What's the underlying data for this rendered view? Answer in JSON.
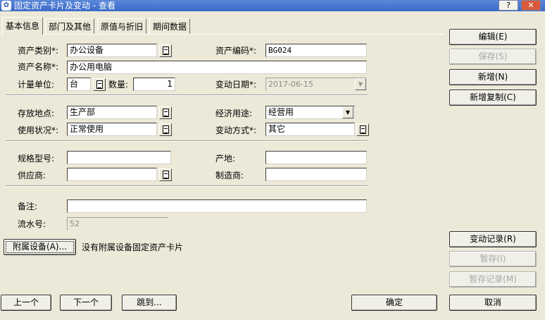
{
  "window": {
    "title": "固定资产卡片及变动 - 查看",
    "help_label": "?",
    "close_label": "✕"
  },
  "tabs": [
    {
      "label": "基本信息",
      "active": true
    },
    {
      "label": "部门及其他",
      "active": false
    },
    {
      "label": "原值与折旧",
      "active": false
    },
    {
      "label": "期间数据",
      "active": false
    }
  ],
  "form": {
    "asset_category": {
      "label": "资产类别*:",
      "value": "办公设备"
    },
    "asset_code": {
      "label": "资产编码*:",
      "value": "BG024"
    },
    "asset_name": {
      "label": "资产名称*:",
      "value": "办公用电脑"
    },
    "unit": {
      "label": "计量单位:",
      "value": "台"
    },
    "quantity": {
      "label": "数量:",
      "value": "1"
    },
    "change_date": {
      "label": "变动日期*:",
      "value": "2017-06-15"
    },
    "location": {
      "label": "存放地点:",
      "value": "生产部"
    },
    "economic_use": {
      "label": "经济用途:",
      "value": "经营用"
    },
    "usage_status": {
      "label": "使用状况*:",
      "value": "正常使用"
    },
    "change_method": {
      "label": "变动方式*:",
      "value": "其它"
    },
    "spec_model": {
      "label": "规格型号:",
      "value": ""
    },
    "origin": {
      "label": "产地:",
      "value": ""
    },
    "supplier": {
      "label": "供应商:",
      "value": ""
    },
    "manufacturer": {
      "label": "制造商:",
      "value": ""
    },
    "remarks": {
      "label": "备注:",
      "value": ""
    },
    "serial_no": {
      "label": "流水号:",
      "value": "52"
    }
  },
  "attached": {
    "button_label": "附属设备(A)...",
    "message": "没有附属设备固定资产卡片"
  },
  "side_buttons": {
    "edit": "编辑(E)",
    "save": "保存(S)",
    "add": "新增(N)",
    "add_copy": "新增复制(C)",
    "change_records": "变动记录(R)",
    "temp_save": "暂存(I)",
    "temp_records": "暂存记录(M)",
    "cancel": "取消"
  },
  "bottom_buttons": {
    "prev": "上一个",
    "next": "下一个",
    "jump": "跳到...",
    "ok": "确定"
  }
}
